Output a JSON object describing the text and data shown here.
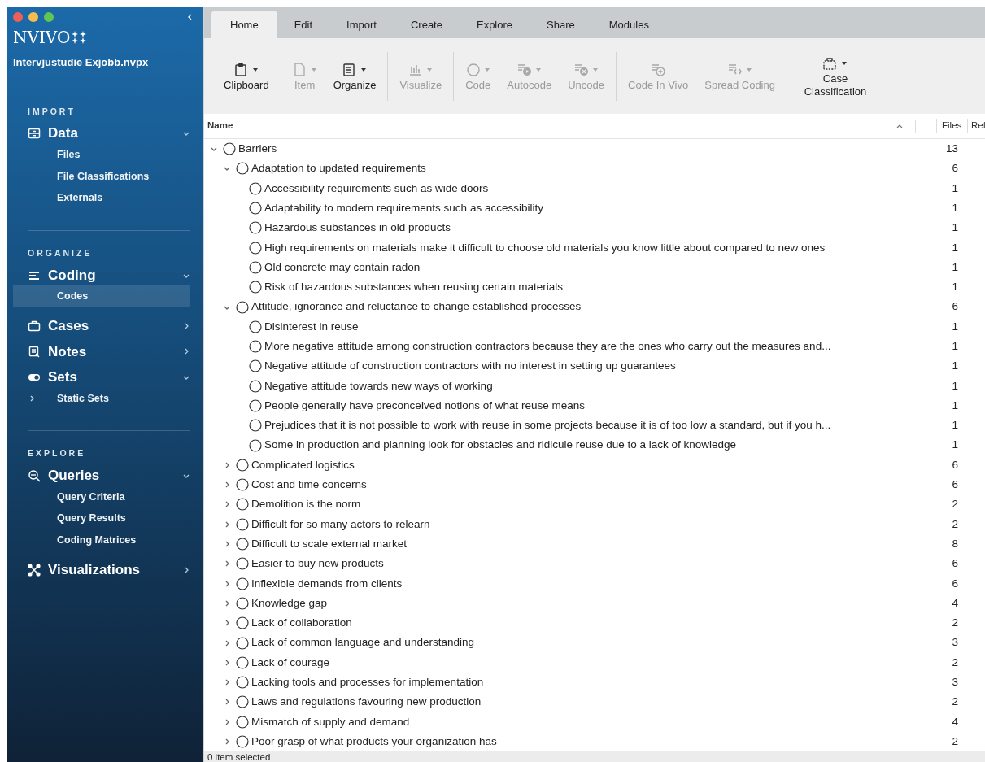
{
  "sidebar": {
    "app_name": "NVIVO",
    "project": "Intervjustudie Exjobb.nvpx",
    "sections": [
      {
        "heading": "IMPORT",
        "items": [
          {
            "label": "Data",
            "expanded": true,
            "children": [
              {
                "label": "Files",
                "selected": false
              },
              {
                "label": "File Classifications",
                "selected": false
              },
              {
                "label": "Externals",
                "selected": false
              }
            ]
          }
        ]
      },
      {
        "heading": "ORGANIZE",
        "items": [
          {
            "label": "Coding",
            "expanded": true,
            "children": [
              {
                "label": "Codes",
                "selected": true
              }
            ]
          },
          {
            "label": "Cases",
            "expanded": false
          },
          {
            "label": "Notes",
            "expanded": false
          },
          {
            "label": "Sets",
            "expanded": true,
            "children": [
              {
                "label": "Static Sets",
                "selected": false,
                "expanded": false
              }
            ]
          }
        ]
      },
      {
        "heading": "EXPLORE",
        "items": [
          {
            "label": "Queries",
            "expanded": true,
            "children": [
              {
                "label": "Query Criteria",
                "selected": false
              },
              {
                "label": "Query Results",
                "selected": false
              },
              {
                "label": "Coding Matrices",
                "selected": false
              }
            ]
          },
          {
            "label": "Visualizations",
            "expanded": false
          }
        ]
      }
    ]
  },
  "tabs": [
    {
      "label": "Home",
      "selected": true
    },
    {
      "label": "Edit",
      "selected": false
    },
    {
      "label": "Import",
      "selected": false
    },
    {
      "label": "Create",
      "selected": false
    },
    {
      "label": "Explore",
      "selected": false
    },
    {
      "label": "Share",
      "selected": false
    },
    {
      "label": "Modules",
      "selected": false
    }
  ],
  "ribbon": {
    "groups": [
      [
        {
          "label": "Clipboard",
          "disabled": false,
          "dropdown": true
        }
      ],
      [
        {
          "label": "Item",
          "disabled": true,
          "dropdown": true
        },
        {
          "label": "Organize",
          "disabled": false,
          "dropdown": true
        }
      ],
      [
        {
          "label": "Visualize",
          "disabled": true,
          "dropdown": true
        }
      ],
      [
        {
          "label": "Code",
          "disabled": true,
          "dropdown": true
        },
        {
          "label": "Autocode",
          "disabled": true,
          "dropdown": true
        },
        {
          "label": "Uncode",
          "disabled": true,
          "dropdown": true
        }
      ],
      [
        {
          "label": "Code In Vivo",
          "disabled": true,
          "dropdown": false
        },
        {
          "label": "Spread Coding",
          "disabled": true,
          "dropdown": true
        }
      ],
      [
        {
          "label": "Case Classification",
          "disabled": false,
          "dropdown": true
        }
      ]
    ]
  },
  "table": {
    "columns": [
      "Name",
      "Files",
      "Ref"
    ],
    "rows": [
      {
        "name": "Barriers",
        "files": "13",
        "expanded": true,
        "children": [
          {
            "name": "Adaptation to updated requirements",
            "files": "6",
            "expanded": true,
            "children": [
              {
                "name": "Accessibility requirements such as wide doors",
                "files": "1"
              },
              {
                "name": "Adaptability to modern requirements such as accessibility",
                "files": "1"
              },
              {
                "name": "Hazardous substances in old products",
                "files": "1"
              },
              {
                "name": "High requirements on materials make it difficult to choose old materials you know little about compared to new ones",
                "files": "1"
              },
              {
                "name": "Old concrete may contain radon",
                "files": "1"
              },
              {
                "name": "Risk of hazardous substances when reusing certain materials",
                "files": "1"
              }
            ]
          },
          {
            "name": "Attitude, ignorance and reluctance to change established processes",
            "files": "6",
            "expanded": true,
            "children": [
              {
                "name": "Disinterest in reuse",
                "files": "1"
              },
              {
                "name": "More negative attitude among construction contractors because they are the ones who carry out the measures and...",
                "files": "1"
              },
              {
                "name": "Negative attitude of construction contractors with no interest in setting up guarantees",
                "files": "1"
              },
              {
                "name": "Negative attitude towards new ways of working",
                "files": "1"
              },
              {
                "name": "People generally have preconceived notions of what reuse means",
                "files": "1"
              },
              {
                "name": "Prejudices that it is not possible to work with reuse in some projects because it is of too low a standard, but if you h...",
                "files": "1"
              },
              {
                "name": "Some in production and planning look for obstacles and ridicule reuse due to a lack of knowledge",
                "files": "1"
              }
            ]
          },
          {
            "name": "Complicated logistics",
            "files": "6",
            "expanded": false
          },
          {
            "name": "Cost and time concerns",
            "files": "6",
            "expanded": false
          },
          {
            "name": "Demolition is the norm",
            "files": "2",
            "expanded": false
          },
          {
            "name": "Difficult for so many actors to relearn",
            "files": "2",
            "expanded": false
          },
          {
            "name": "Difficult to scale external market",
            "files": "8",
            "expanded": false
          },
          {
            "name": "Easier to buy new products",
            "files": "6",
            "expanded": false
          },
          {
            "name": "Inflexible demands from clients",
            "files": "6",
            "expanded": false
          },
          {
            "name": "Knowledge gap",
            "files": "4",
            "expanded": false
          },
          {
            "name": "Lack of collaboration",
            "files": "2",
            "expanded": false
          },
          {
            "name": "Lack of common language and understanding",
            "files": "3",
            "expanded": false
          },
          {
            "name": "Lack of courage",
            "files": "2",
            "expanded": false
          },
          {
            "name": "Lacking tools and processes for implementation",
            "files": "3",
            "expanded": false
          },
          {
            "name": "Laws and regulations favouring new production",
            "files": "2",
            "expanded": false
          },
          {
            "name": "Mismatch of supply and demand",
            "files": "4",
            "expanded": false
          },
          {
            "name": "Poor grasp of what products your organization has",
            "files": "2",
            "expanded": false
          }
        ]
      }
    ]
  },
  "status_bar": "0 item selected"
}
